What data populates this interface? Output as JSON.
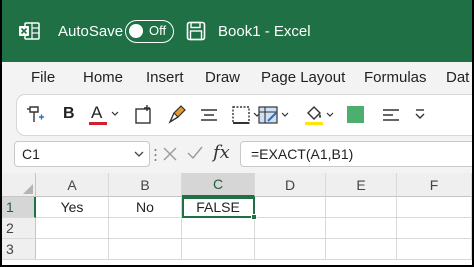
{
  "titlebar": {
    "autosave_label": "AutoSave",
    "autosave_state": "Off",
    "book_title": "Book1  -  Excel"
  },
  "tabs": [
    {
      "label": "File"
    },
    {
      "label": "Home"
    },
    {
      "label": "Insert"
    },
    {
      "label": "Draw"
    },
    {
      "label": "Page Layout"
    },
    {
      "label": "Formulas"
    },
    {
      "label": "Dat"
    }
  ],
  "toolbar": {
    "bold_label": "B",
    "font_color_label": "A",
    "font_color_swatch": "#d11f2f",
    "highlight_swatch": "#ffe600",
    "fill_swatch": "#4caf6e"
  },
  "formula_bar": {
    "name_box": "C1",
    "fx_label": "fx",
    "formula": "=EXACT(A1,B1)"
  },
  "grid": {
    "columns": [
      "A",
      "B",
      "C",
      "D",
      "E",
      "F"
    ],
    "rows": [
      "1",
      "2",
      "3"
    ],
    "cells": {
      "A1": "Yes",
      "B1": "No",
      "C1": "FALSE"
    },
    "accent": "#1f7145"
  },
  "icons": {
    "app": "excel-logo-icon",
    "save": "save-icon",
    "cancel": "cancel-icon",
    "enter": "enter-icon"
  }
}
